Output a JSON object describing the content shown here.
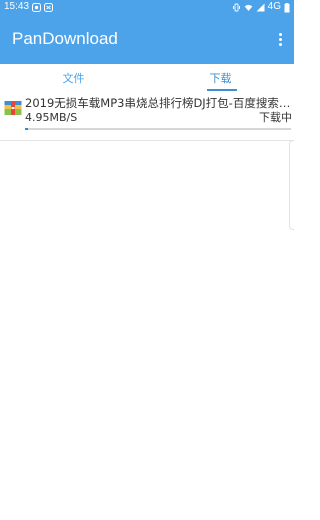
{
  "status_bar": {
    "time": "15:43",
    "network": "4G",
    "icons": [
      "app-notification-icon",
      "app-notification-icon-2",
      "vibrate-icon",
      "wifi-icon",
      "signal-icon",
      "battery-icon"
    ]
  },
  "app_bar": {
    "title": "PanDownload",
    "overflow_icon": "more-vert-icon",
    "background_color": "#4da3ea"
  },
  "tabs": [
    {
      "label": "文件",
      "selected": false
    },
    {
      "label": "下载",
      "selected": true
    }
  ],
  "downloads": [
    {
      "name": "2019无损车载MP3串烧总排行榜DJ打包-百度搜索…",
      "speed": "4.95MB/S",
      "status": "下载中",
      "progress": 0.01,
      "icon": "archive-file-icon"
    }
  ]
}
